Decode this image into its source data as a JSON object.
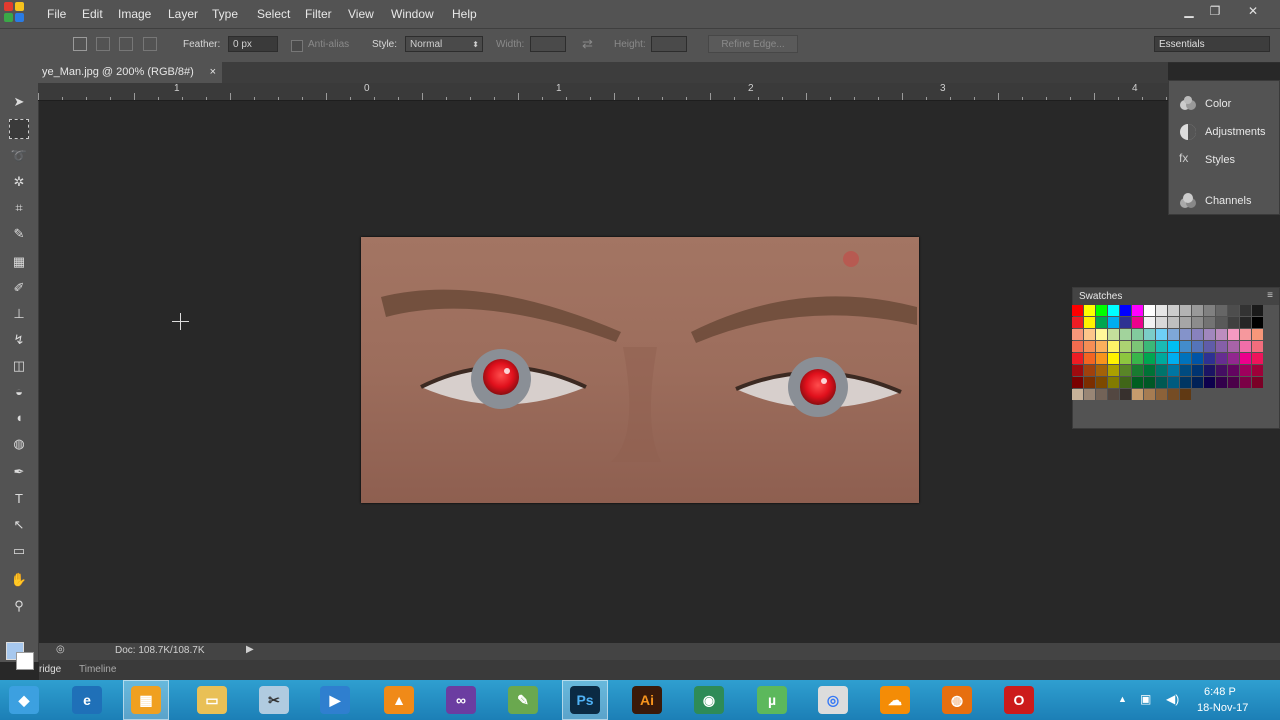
{
  "menu": [
    "File",
    "Edit",
    "Image",
    "Layer",
    "Type",
    "Select",
    "Filter",
    "View",
    "Window",
    "Help"
  ],
  "options": {
    "feather_label": "Feather:",
    "feather_value": "0 px",
    "antialias_label": "Anti-alias",
    "style_label": "Style:",
    "style_value": "Normal",
    "width_label": "Width:",
    "height_label": "Height:",
    "refine_edge": "Refine Edge...",
    "workspace": "Essentials"
  },
  "document": {
    "tab_title": "ye_Man.jpg @ 200% (RGB/8#)",
    "status": "Doc: 108.7K/108.7K"
  },
  "ruler": {
    "numbers": [
      "1",
      "0",
      "1",
      "2",
      "3",
      "4"
    ]
  },
  "panels": {
    "color": "Color",
    "adjustments": "Adjustments",
    "styles": "Styles",
    "channels": "Channels",
    "swatches": "Swatches"
  },
  "bottom_tabs": [
    "ridge",
    "Timeline"
  ],
  "taskbar": {
    "time": "6:48 P",
    "date": "18-Nov-17",
    "photoshop_label": "Ps",
    "illustrator_label": "Ai"
  },
  "colors": {
    "ui_dark": "#535353",
    "canvas_bg": "#282828",
    "taskbar": "#2a95c9",
    "red_eye": "#e0101c"
  }
}
